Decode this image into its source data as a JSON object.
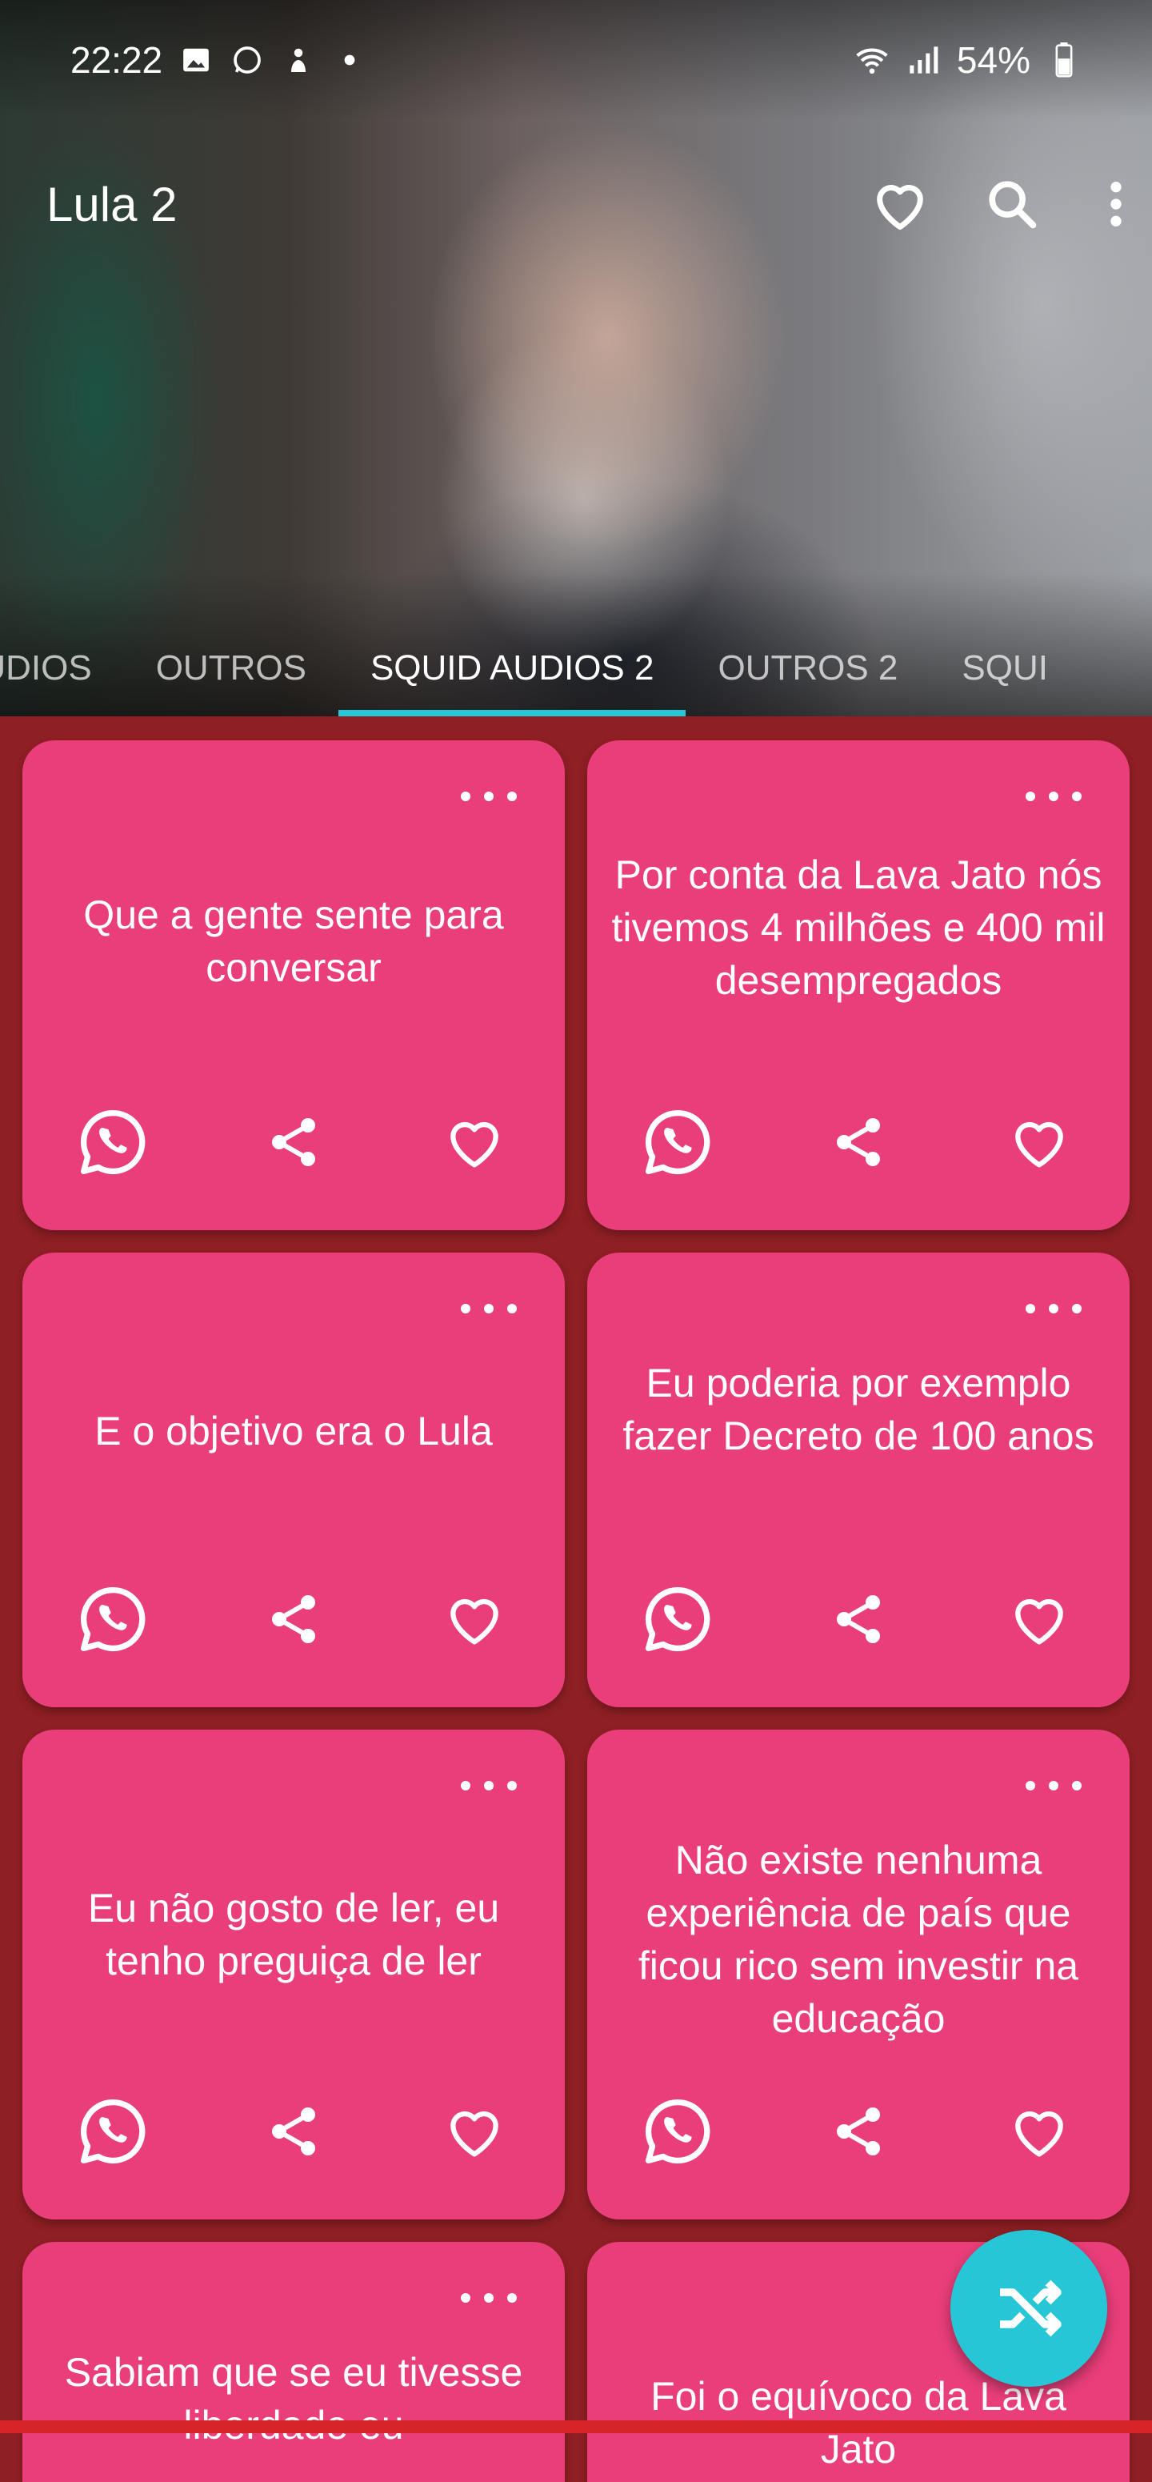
{
  "status_bar": {
    "time": "22:22",
    "battery": "54%"
  },
  "toolbar": {
    "title": "Lula 2"
  },
  "tabs": [
    {
      "label": "AUDIOS"
    },
    {
      "label": "OUTROS"
    },
    {
      "label": "SQUID AUDIOS 2",
      "active": true
    },
    {
      "label": "OUTROS 2"
    },
    {
      "label": "SQUI"
    }
  ],
  "cards": [
    {
      "text": "Que a gente sente para conversar"
    },
    {
      "text": "Por conta da Lava Jato nós tivemos 4 milhões e 400 mil desempregados"
    },
    {
      "text": "E o objetivo era o Lula"
    },
    {
      "text": "Eu poderia por exemplo fazer Decreto de 100 anos"
    },
    {
      "text": "Eu não gosto de ler, eu tenho preguiça de ler"
    },
    {
      "text": "Não existe nenhuma experiência de país que ficou rico sem investir na educação"
    },
    {
      "text": "Sabiam que se eu tivesse liberdade eu"
    },
    {
      "text": "Foi o equívoco da Lava Jato"
    }
  ],
  "icons": {
    "whatsapp": "whatsapp-icon",
    "share": "share-icon",
    "favorite": "heart-outline-icon",
    "more": "more-horizontal-icon",
    "shuffle": "shuffle-icon"
  },
  "colors": {
    "background": "#8e1f24",
    "card": "#e93e7a",
    "accent": "#27c6d6"
  }
}
